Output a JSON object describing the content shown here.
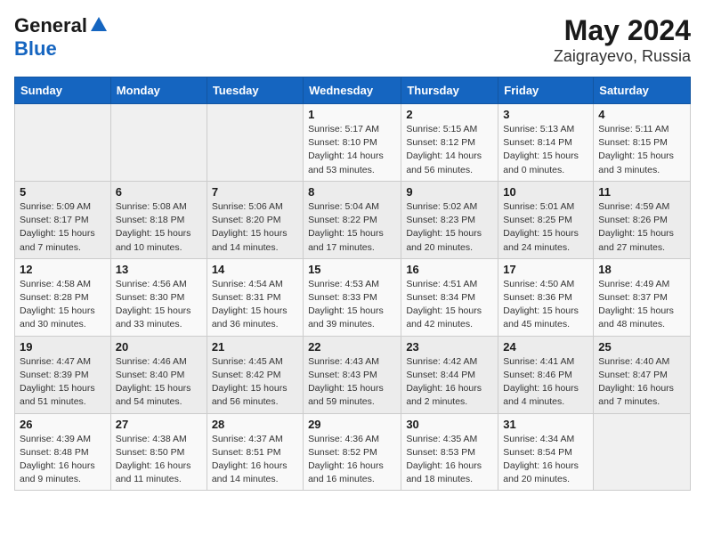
{
  "logo": {
    "line1": "General",
    "line2": "Blue"
  },
  "title": "May 2024",
  "subtitle": "Zaigrayevo, Russia",
  "days_of_week": [
    "Sunday",
    "Monday",
    "Tuesday",
    "Wednesday",
    "Thursday",
    "Friday",
    "Saturday"
  ],
  "weeks": [
    [
      {
        "day": "",
        "info": ""
      },
      {
        "day": "",
        "info": ""
      },
      {
        "day": "",
        "info": ""
      },
      {
        "day": "1",
        "info": "Sunrise: 5:17 AM\nSunset: 8:10 PM\nDaylight: 14 hours and 53 minutes."
      },
      {
        "day": "2",
        "info": "Sunrise: 5:15 AM\nSunset: 8:12 PM\nDaylight: 14 hours and 56 minutes."
      },
      {
        "day": "3",
        "info": "Sunrise: 5:13 AM\nSunset: 8:14 PM\nDaylight: 15 hours and 0 minutes."
      },
      {
        "day": "4",
        "info": "Sunrise: 5:11 AM\nSunset: 8:15 PM\nDaylight: 15 hours and 3 minutes."
      }
    ],
    [
      {
        "day": "5",
        "info": "Sunrise: 5:09 AM\nSunset: 8:17 PM\nDaylight: 15 hours and 7 minutes."
      },
      {
        "day": "6",
        "info": "Sunrise: 5:08 AM\nSunset: 8:18 PM\nDaylight: 15 hours and 10 minutes."
      },
      {
        "day": "7",
        "info": "Sunrise: 5:06 AM\nSunset: 8:20 PM\nDaylight: 15 hours and 14 minutes."
      },
      {
        "day": "8",
        "info": "Sunrise: 5:04 AM\nSunset: 8:22 PM\nDaylight: 15 hours and 17 minutes."
      },
      {
        "day": "9",
        "info": "Sunrise: 5:02 AM\nSunset: 8:23 PM\nDaylight: 15 hours and 20 minutes."
      },
      {
        "day": "10",
        "info": "Sunrise: 5:01 AM\nSunset: 8:25 PM\nDaylight: 15 hours and 24 minutes."
      },
      {
        "day": "11",
        "info": "Sunrise: 4:59 AM\nSunset: 8:26 PM\nDaylight: 15 hours and 27 minutes."
      }
    ],
    [
      {
        "day": "12",
        "info": "Sunrise: 4:58 AM\nSunset: 8:28 PM\nDaylight: 15 hours and 30 minutes."
      },
      {
        "day": "13",
        "info": "Sunrise: 4:56 AM\nSunset: 8:30 PM\nDaylight: 15 hours and 33 minutes."
      },
      {
        "day": "14",
        "info": "Sunrise: 4:54 AM\nSunset: 8:31 PM\nDaylight: 15 hours and 36 minutes."
      },
      {
        "day": "15",
        "info": "Sunrise: 4:53 AM\nSunset: 8:33 PM\nDaylight: 15 hours and 39 minutes."
      },
      {
        "day": "16",
        "info": "Sunrise: 4:51 AM\nSunset: 8:34 PM\nDaylight: 15 hours and 42 minutes."
      },
      {
        "day": "17",
        "info": "Sunrise: 4:50 AM\nSunset: 8:36 PM\nDaylight: 15 hours and 45 minutes."
      },
      {
        "day": "18",
        "info": "Sunrise: 4:49 AM\nSunset: 8:37 PM\nDaylight: 15 hours and 48 minutes."
      }
    ],
    [
      {
        "day": "19",
        "info": "Sunrise: 4:47 AM\nSunset: 8:39 PM\nDaylight: 15 hours and 51 minutes."
      },
      {
        "day": "20",
        "info": "Sunrise: 4:46 AM\nSunset: 8:40 PM\nDaylight: 15 hours and 54 minutes."
      },
      {
        "day": "21",
        "info": "Sunrise: 4:45 AM\nSunset: 8:42 PM\nDaylight: 15 hours and 56 minutes."
      },
      {
        "day": "22",
        "info": "Sunrise: 4:43 AM\nSunset: 8:43 PM\nDaylight: 15 hours and 59 minutes."
      },
      {
        "day": "23",
        "info": "Sunrise: 4:42 AM\nSunset: 8:44 PM\nDaylight: 16 hours and 2 minutes."
      },
      {
        "day": "24",
        "info": "Sunrise: 4:41 AM\nSunset: 8:46 PM\nDaylight: 16 hours and 4 minutes."
      },
      {
        "day": "25",
        "info": "Sunrise: 4:40 AM\nSunset: 8:47 PM\nDaylight: 16 hours and 7 minutes."
      }
    ],
    [
      {
        "day": "26",
        "info": "Sunrise: 4:39 AM\nSunset: 8:48 PM\nDaylight: 16 hours and 9 minutes."
      },
      {
        "day": "27",
        "info": "Sunrise: 4:38 AM\nSunset: 8:50 PM\nDaylight: 16 hours and 11 minutes."
      },
      {
        "day": "28",
        "info": "Sunrise: 4:37 AM\nSunset: 8:51 PM\nDaylight: 16 hours and 14 minutes."
      },
      {
        "day": "29",
        "info": "Sunrise: 4:36 AM\nSunset: 8:52 PM\nDaylight: 16 hours and 16 minutes."
      },
      {
        "day": "30",
        "info": "Sunrise: 4:35 AM\nSunset: 8:53 PM\nDaylight: 16 hours and 18 minutes."
      },
      {
        "day": "31",
        "info": "Sunrise: 4:34 AM\nSunset: 8:54 PM\nDaylight: 16 hours and 20 minutes."
      },
      {
        "day": "",
        "info": ""
      }
    ]
  ]
}
